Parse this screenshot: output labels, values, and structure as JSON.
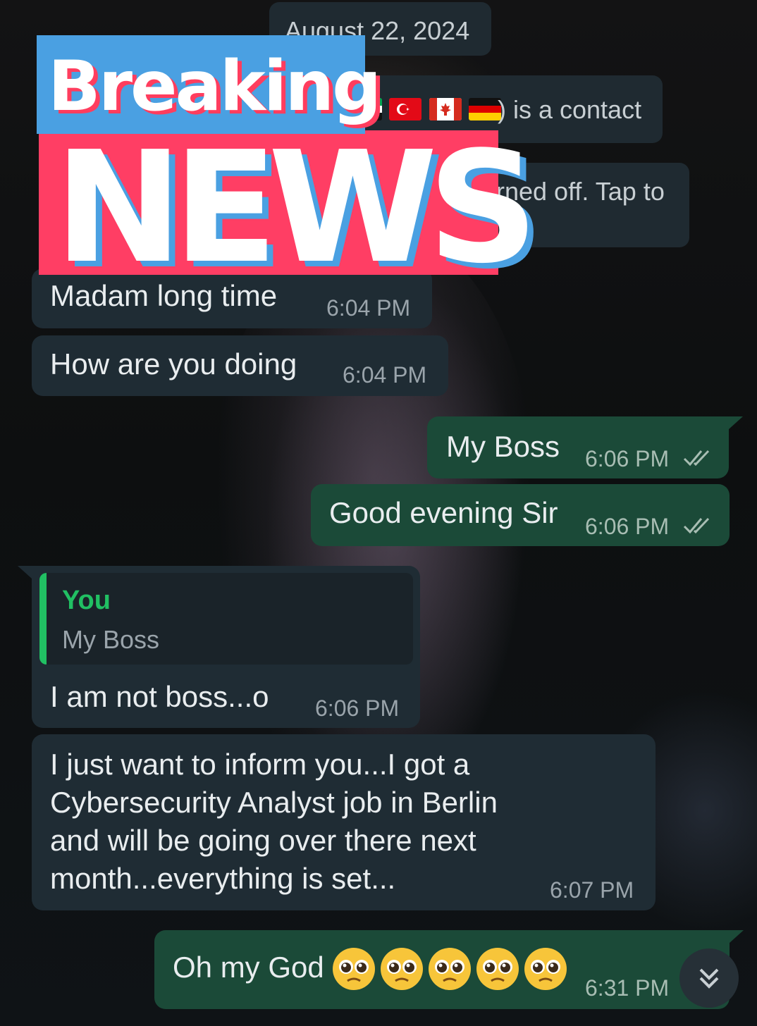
{
  "date_chip": "August 22, 2024",
  "contact_notice": {
    "flags": [
      "UAE flag",
      "Turkey flag",
      "Canada flag",
      "Germany flag"
    ],
    "text": ") is a contact"
  },
  "encryption_notice": {
    "text": "rned off. Tap to"
  },
  "breaking_news": {
    "line1": "Breaking",
    "line2": "NEWS"
  },
  "messages": [
    {
      "direction": "incoming",
      "text": "Madam long time",
      "time": "6:04 PM"
    },
    {
      "direction": "incoming",
      "text": "How are you doing",
      "time": "6:04 PM"
    },
    {
      "direction": "outgoing",
      "text": "My Boss",
      "time": "6:06 PM",
      "status": "read"
    },
    {
      "direction": "outgoing",
      "text": "Good evening Sir",
      "time": "6:06 PM",
      "status": "read"
    },
    {
      "direction": "incoming",
      "quote_author": "You",
      "quote_text": "My Boss",
      "text": "I am not boss...o",
      "time": "6:06 PM"
    },
    {
      "direction": "incoming",
      "lines": [
        "I just want to inform you...I got a",
        "Cybersecurity Analyst job in Berlin",
        "and will be going over there next",
        "month...everything is set..."
      ],
      "time": "6:07 PM"
    },
    {
      "direction": "outgoing",
      "text": "Oh my God",
      "emoji_count": 5,
      "emoji_name": "pleading-face",
      "time": "6:31 PM"
    }
  ],
  "colors": {
    "incoming_bubble": "#1f2c34",
    "outgoing_bubble": "#1b4a38",
    "quote_accent": "#21c063",
    "read_ticks": "#a8bdb3",
    "banner_blue": "#4aa0e2",
    "banner_red": "#ff3e64"
  },
  "icons": {
    "read_receipt": "double-check-icon",
    "scroll_down": "double-chevron-down-icon"
  }
}
